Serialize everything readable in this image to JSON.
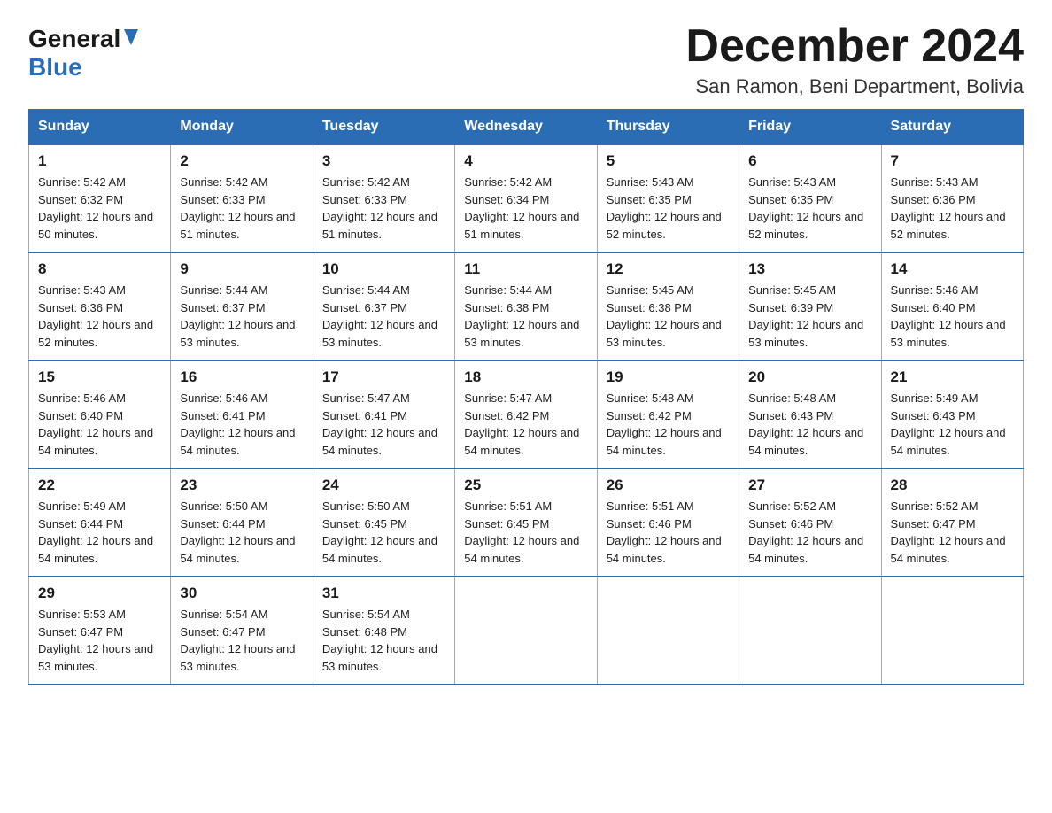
{
  "header": {
    "logo_general": "General",
    "logo_blue": "Blue",
    "month_title": "December 2024",
    "location": "San Ramon, Beni Department, Bolivia"
  },
  "weekdays": [
    "Sunday",
    "Monday",
    "Tuesday",
    "Wednesday",
    "Thursday",
    "Friday",
    "Saturday"
  ],
  "weeks": [
    [
      {
        "day": "1",
        "sunrise": "5:42 AM",
        "sunset": "6:32 PM",
        "daylight": "12 hours and 50 minutes."
      },
      {
        "day": "2",
        "sunrise": "5:42 AM",
        "sunset": "6:33 PM",
        "daylight": "12 hours and 51 minutes."
      },
      {
        "day": "3",
        "sunrise": "5:42 AM",
        "sunset": "6:33 PM",
        "daylight": "12 hours and 51 minutes."
      },
      {
        "day": "4",
        "sunrise": "5:42 AM",
        "sunset": "6:34 PM",
        "daylight": "12 hours and 51 minutes."
      },
      {
        "day": "5",
        "sunrise": "5:43 AM",
        "sunset": "6:35 PM",
        "daylight": "12 hours and 52 minutes."
      },
      {
        "day": "6",
        "sunrise": "5:43 AM",
        "sunset": "6:35 PM",
        "daylight": "12 hours and 52 minutes."
      },
      {
        "day": "7",
        "sunrise": "5:43 AM",
        "sunset": "6:36 PM",
        "daylight": "12 hours and 52 minutes."
      }
    ],
    [
      {
        "day": "8",
        "sunrise": "5:43 AM",
        "sunset": "6:36 PM",
        "daylight": "12 hours and 52 minutes."
      },
      {
        "day": "9",
        "sunrise": "5:44 AM",
        "sunset": "6:37 PM",
        "daylight": "12 hours and 53 minutes."
      },
      {
        "day": "10",
        "sunrise": "5:44 AM",
        "sunset": "6:37 PM",
        "daylight": "12 hours and 53 minutes."
      },
      {
        "day": "11",
        "sunrise": "5:44 AM",
        "sunset": "6:38 PM",
        "daylight": "12 hours and 53 minutes."
      },
      {
        "day": "12",
        "sunrise": "5:45 AM",
        "sunset": "6:38 PM",
        "daylight": "12 hours and 53 minutes."
      },
      {
        "day": "13",
        "sunrise": "5:45 AM",
        "sunset": "6:39 PM",
        "daylight": "12 hours and 53 minutes."
      },
      {
        "day": "14",
        "sunrise": "5:46 AM",
        "sunset": "6:40 PM",
        "daylight": "12 hours and 53 minutes."
      }
    ],
    [
      {
        "day": "15",
        "sunrise": "5:46 AM",
        "sunset": "6:40 PM",
        "daylight": "12 hours and 54 minutes."
      },
      {
        "day": "16",
        "sunrise": "5:46 AM",
        "sunset": "6:41 PM",
        "daylight": "12 hours and 54 minutes."
      },
      {
        "day": "17",
        "sunrise": "5:47 AM",
        "sunset": "6:41 PM",
        "daylight": "12 hours and 54 minutes."
      },
      {
        "day": "18",
        "sunrise": "5:47 AM",
        "sunset": "6:42 PM",
        "daylight": "12 hours and 54 minutes."
      },
      {
        "day": "19",
        "sunrise": "5:48 AM",
        "sunset": "6:42 PM",
        "daylight": "12 hours and 54 minutes."
      },
      {
        "day": "20",
        "sunrise": "5:48 AM",
        "sunset": "6:43 PM",
        "daylight": "12 hours and 54 minutes."
      },
      {
        "day": "21",
        "sunrise": "5:49 AM",
        "sunset": "6:43 PM",
        "daylight": "12 hours and 54 minutes."
      }
    ],
    [
      {
        "day": "22",
        "sunrise": "5:49 AM",
        "sunset": "6:44 PM",
        "daylight": "12 hours and 54 minutes."
      },
      {
        "day": "23",
        "sunrise": "5:50 AM",
        "sunset": "6:44 PM",
        "daylight": "12 hours and 54 minutes."
      },
      {
        "day": "24",
        "sunrise": "5:50 AM",
        "sunset": "6:45 PM",
        "daylight": "12 hours and 54 minutes."
      },
      {
        "day": "25",
        "sunrise": "5:51 AM",
        "sunset": "6:45 PM",
        "daylight": "12 hours and 54 minutes."
      },
      {
        "day": "26",
        "sunrise": "5:51 AM",
        "sunset": "6:46 PM",
        "daylight": "12 hours and 54 minutes."
      },
      {
        "day": "27",
        "sunrise": "5:52 AM",
        "sunset": "6:46 PM",
        "daylight": "12 hours and 54 minutes."
      },
      {
        "day": "28",
        "sunrise": "5:52 AM",
        "sunset": "6:47 PM",
        "daylight": "12 hours and 54 minutes."
      }
    ],
    [
      {
        "day": "29",
        "sunrise": "5:53 AM",
        "sunset": "6:47 PM",
        "daylight": "12 hours and 53 minutes."
      },
      {
        "day": "30",
        "sunrise": "5:54 AM",
        "sunset": "6:47 PM",
        "daylight": "12 hours and 53 minutes."
      },
      {
        "day": "31",
        "sunrise": "5:54 AM",
        "sunset": "6:48 PM",
        "daylight": "12 hours and 53 minutes."
      },
      null,
      null,
      null,
      null
    ]
  ],
  "labels": {
    "sunrise_prefix": "Sunrise: ",
    "sunset_prefix": "Sunset: ",
    "daylight_prefix": "Daylight: "
  }
}
